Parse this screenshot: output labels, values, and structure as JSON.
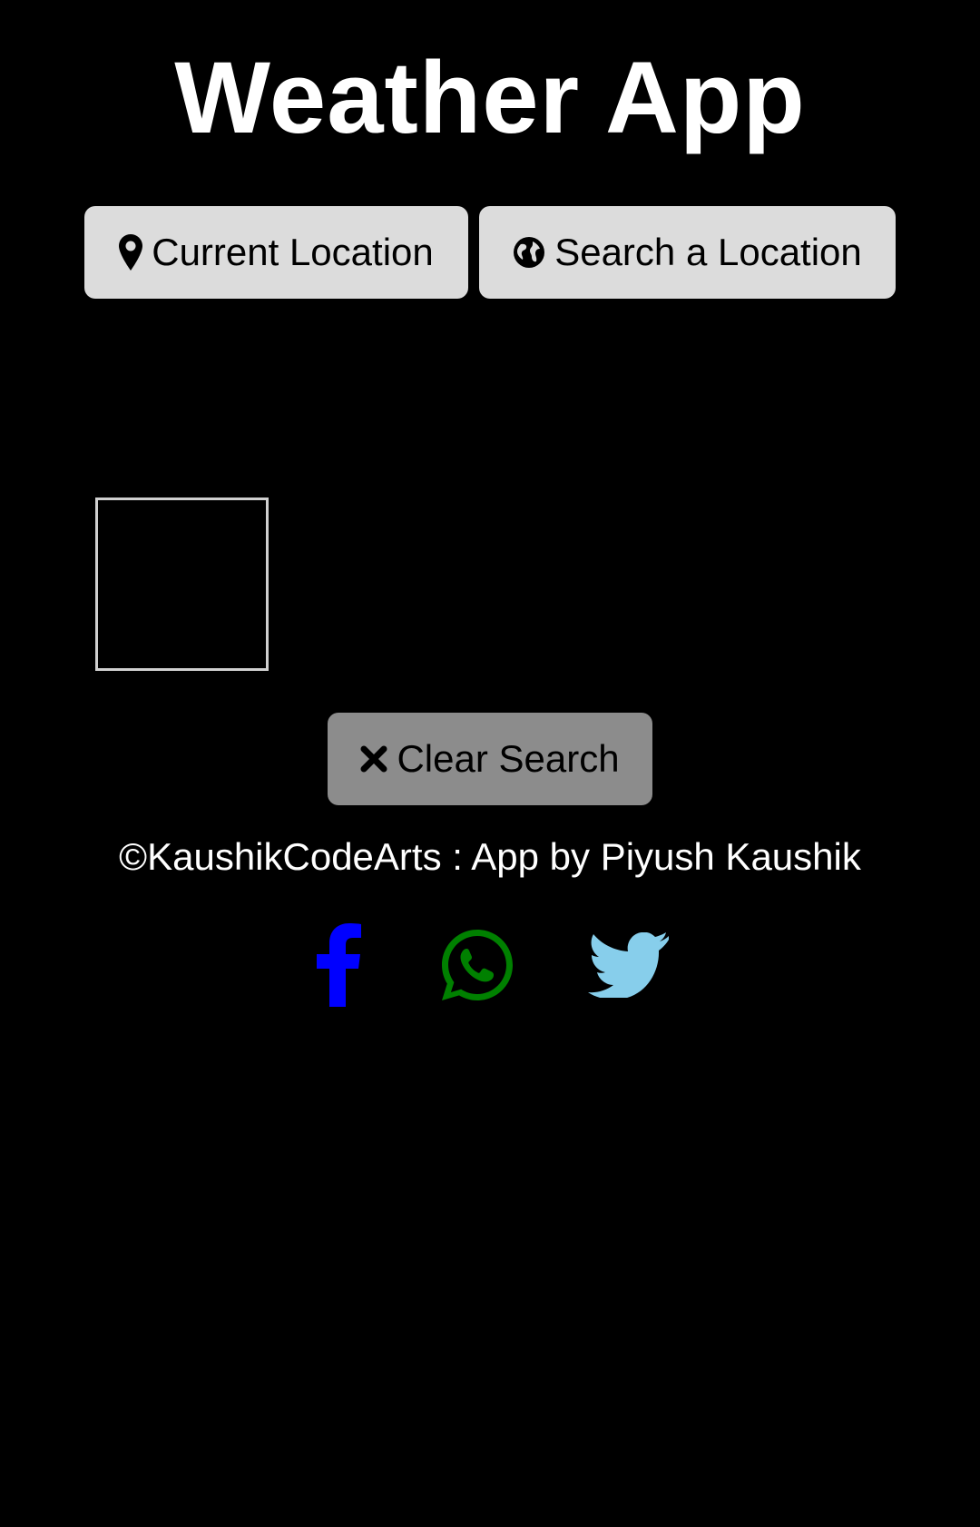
{
  "header": {
    "title": "Weather App"
  },
  "actions": {
    "current_location_label": "Current Location",
    "current_location_icon": "map-marker-icon",
    "search_location_label": "Search a Location",
    "search_location_icon": "globe-icon",
    "clear_search_label": "Clear Search",
    "clear_search_icon": "close-icon"
  },
  "footer": {
    "credit": "©KaushikCodeArts : App by Piyush Kaushik"
  },
  "social": [
    {
      "icon": "facebook-icon",
      "color": "#0000ff"
    },
    {
      "icon": "whatsapp-icon",
      "color": "#008000"
    },
    {
      "icon": "twitter-icon",
      "color": "#87ceeb"
    }
  ],
  "colors": {
    "background": "#000000",
    "button": "#dcdcdc",
    "button_clear": "#8c8c8c",
    "text": "#ffffff"
  }
}
